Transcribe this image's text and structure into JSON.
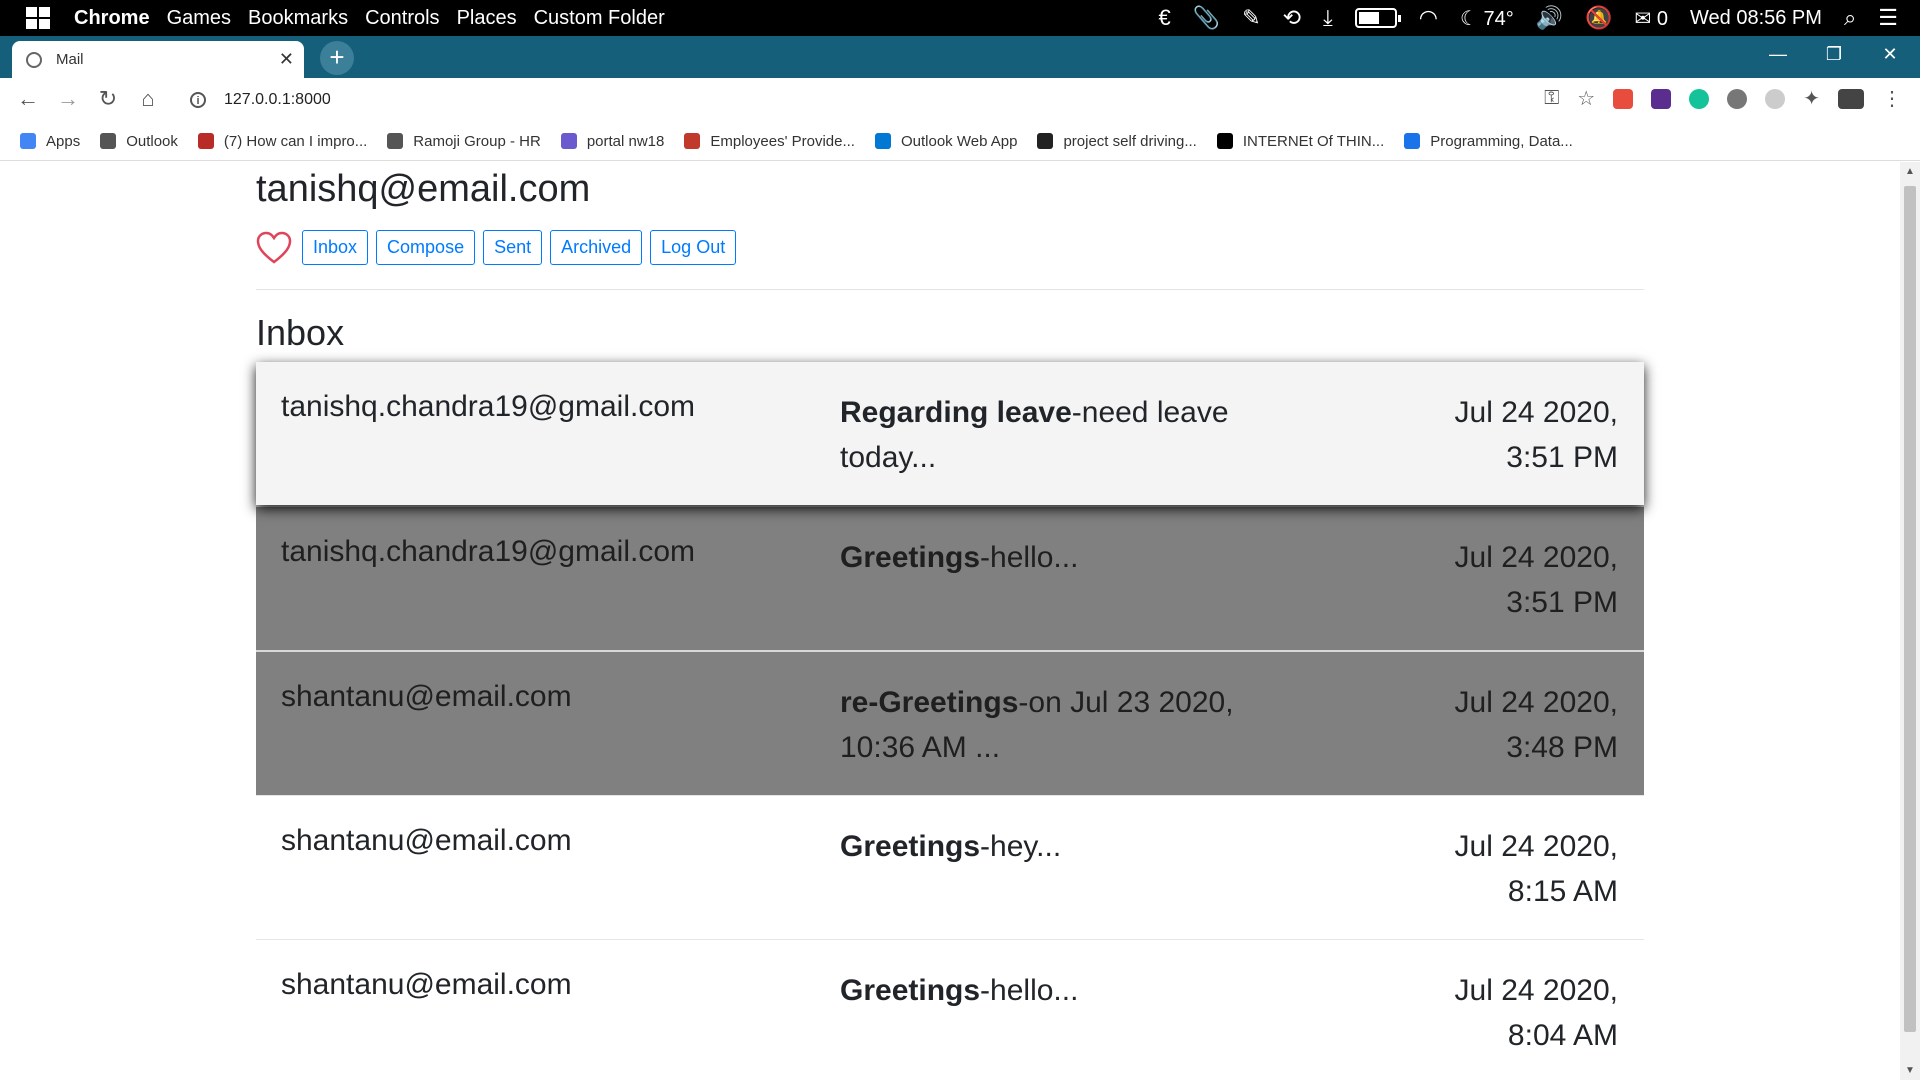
{
  "taskbar": {
    "menu": [
      "Chrome",
      "Games",
      "Bookmarks",
      "Controls",
      "Places",
      "Custom Folder"
    ],
    "temperature": "74°",
    "mail_count": "0",
    "clock": "Wed 08:56 PM"
  },
  "browser": {
    "tab_title": "Mail",
    "url": "127.0.0.1:8000",
    "bookmarks": [
      {
        "label": "Apps",
        "color": "#4285f4"
      },
      {
        "label": "Outlook",
        "color": "#555555"
      },
      {
        "label": "(7) How can I impro...",
        "color": "#b92b27"
      },
      {
        "label": "Ramoji Group - HR",
        "color": "#555555"
      },
      {
        "label": "portal nw18",
        "color": "#6a5acd"
      },
      {
        "label": "Employees' Provide...",
        "color": "#c0392b"
      },
      {
        "label": "Outlook Web App",
        "color": "#0078d4"
      },
      {
        "label": "project self driving...",
        "color": "#222222"
      },
      {
        "label": "INTERNEt Of THIN...",
        "color": "#000000"
      },
      {
        "label": "Programming, Data...",
        "color": "#1a73e8"
      }
    ]
  },
  "app": {
    "user_email": "tanishq@email.com",
    "nav": {
      "inbox": "Inbox",
      "compose": "Compose",
      "sent": "Sent",
      "archived": "Archived",
      "logout": "Log Out"
    },
    "heading": "Inbox",
    "emails": [
      {
        "sender": "tanishq.chandra19@gmail.com",
        "subject": "Regarding leave",
        "preview": "-need leave today...",
        "date": "Jul 24 2020,",
        "time": "3:51 PM"
      },
      {
        "sender": "tanishq.chandra19@gmail.com",
        "subject": "Greetings",
        "preview": "-hello...",
        "date": "Jul 24 2020,",
        "time": "3:51 PM"
      },
      {
        "sender": "shantanu@email.com",
        "subject": "re-Greetings",
        "preview": "-on Jul 23 2020, 10:36 AM ...",
        "date": "Jul 24 2020,",
        "time": "3:48 PM"
      },
      {
        "sender": "shantanu@email.com",
        "subject": "Greetings",
        "preview": "-hey...",
        "date": "Jul 24 2020,",
        "time": "8:15 AM"
      },
      {
        "sender": "shantanu@email.com",
        "subject": "Greetings",
        "preview": "-hello...",
        "date": "Jul 24 2020,",
        "time": "8:04 AM"
      }
    ]
  },
  "colors": {
    "accent": "#007bff",
    "read_row": "#808080",
    "tabstrip": "#155f7b"
  }
}
